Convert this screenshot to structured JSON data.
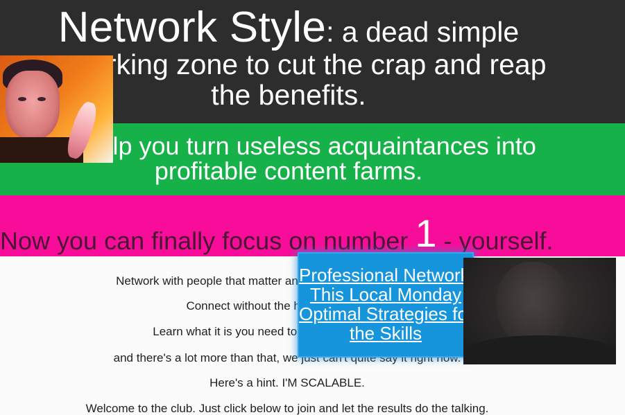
{
  "hero": {
    "title_big": "Network Style",
    "title_rest": ": a dead simple",
    "line2": "networking zone to cut the crap and reap",
    "line3": "the benefits."
  },
  "green_band": {
    "line1": "We help you turn useless acquaintances into",
    "line2": "profitable content farms."
  },
  "pink_band": {
    "prefix": "Now you can finally focus on number ",
    "number": "1",
    "suffix": " - yourself."
  },
  "copy": [
    "Network with people that matter and eliminate the ones that don't.",
    "Connect without the hassle of feelings.",
    "Learn what it is you need to get ahead in this world.",
    "and there's a lot more than that, we just can't quite say it right now.",
    "Here's a hint. I'M SCALABLE.",
    "Welcome to the club. Just click below to join and let the results do the talking."
  ],
  "popup": {
    "links": [
      "Professional Networking",
      "This Local Monday",
      "Optimal Strategies for",
      "the Skills"
    ]
  },
  "colors": {
    "hero_bg": "#2d2d2d",
    "green": "#16b148",
    "pink": "#f70d9a",
    "popup": "#1694dc"
  }
}
